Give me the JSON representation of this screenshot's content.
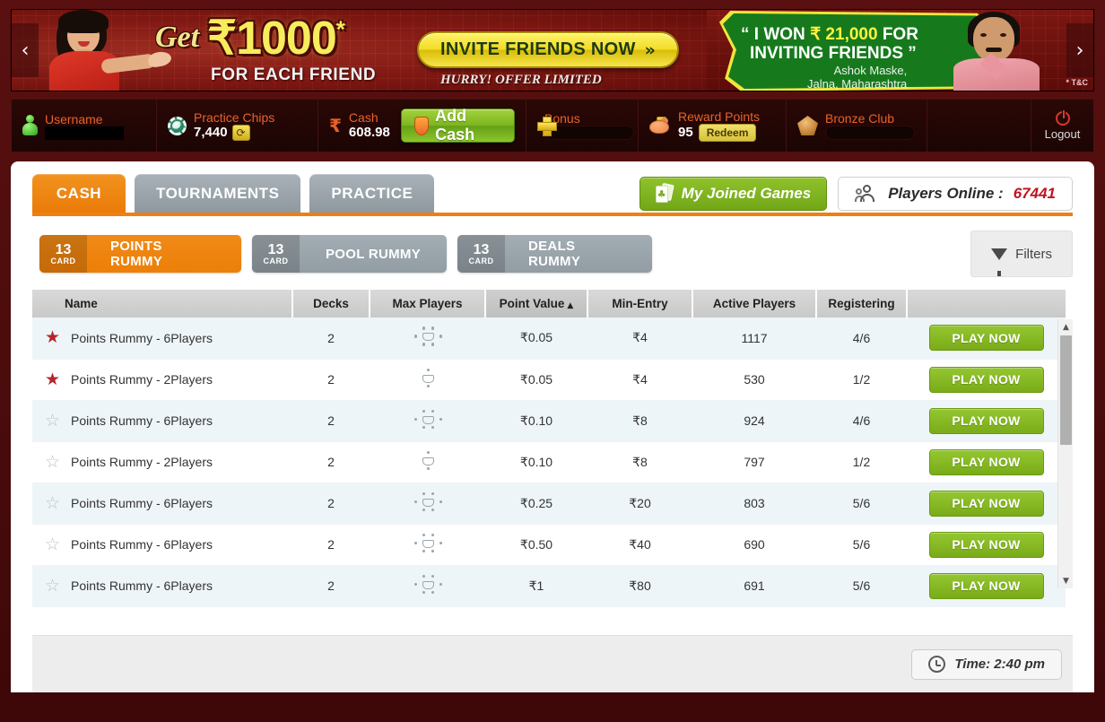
{
  "banner": {
    "prev_arrow": "‹",
    "next_arrow": "›",
    "get_word": "Get",
    "amount": "₹1000",
    "amount_star": "*",
    "for_each_friend": "FOR EACH FRIEND",
    "invite_label": "INVITE FRIENDS NOW",
    "invite_chevron": "»",
    "hurry": "HURRY! OFFER LIMITED",
    "quote_line1_pre": "“ I WON ",
    "quote_amount": "₹ 21,000",
    "quote_line1_post": " FOR",
    "quote_line2": "INVITING FRIENDS ”",
    "winner_name": "Ashok Maske,",
    "winner_place": "Jalna, Maharashtra",
    "tac": "* T&C"
  },
  "userbar": {
    "username_label": "Username",
    "username_value": "",
    "practice_label": "Practice Chips",
    "practice_value": "7,440",
    "refresh_icon": "⟳",
    "cash_label": "Cash",
    "cash_value": "608.98",
    "rupee_symbol": "₹",
    "add_cash_label": "Add Cash",
    "bonus_label": "Bonus",
    "bonus_value": "",
    "reward_label": "Reward Points",
    "reward_value": "95",
    "redeem_label": "Redeem",
    "bronze_label": "Bronze Club",
    "bronze_value": "",
    "logout_label": "Logout"
  },
  "main_tabs": [
    {
      "label": "CASH",
      "active": true
    },
    {
      "label": "TOURNAMENTS",
      "active": false
    },
    {
      "label": "PRACTICE",
      "active": false
    }
  ],
  "joined_games_label": "My Joined Games",
  "players_online": {
    "label": "Players Online :",
    "count": "67441"
  },
  "game_tabs": [
    {
      "num": "13",
      "sub": "CARD",
      "name": "POINTS RUMMY",
      "active": true
    },
    {
      "num": "13",
      "sub": "CARD",
      "name": "POOL RUMMY",
      "active": false
    },
    {
      "num": "13",
      "sub": "CARD",
      "name": "DEALS RUMMY",
      "active": false
    }
  ],
  "filters_label": "Filters",
  "table": {
    "columns": [
      "Name",
      "Decks",
      "Max Players",
      "Point Value",
      "Min-Entry",
      "Active Players",
      "Registering",
      ""
    ],
    "sort_column": "Point Value",
    "sort_indicator": "▲",
    "rows": [
      {
        "fav": "filled",
        "name": "Points Rummy - 6Players",
        "decks": "2",
        "max_players": "6",
        "point_value": "₹0.05",
        "min_entry": "₹4",
        "active_players": "1117",
        "registering": "4/6",
        "action": "PLAY NOW"
      },
      {
        "fav": "filled",
        "name": "Points Rummy - 2Players",
        "decks": "2",
        "max_players": "2",
        "point_value": "₹0.05",
        "min_entry": "₹4",
        "active_players": "530",
        "registering": "1/2",
        "action": "PLAY NOW"
      },
      {
        "fav": "empty",
        "name": "Points Rummy - 6Players",
        "decks": "2",
        "max_players": "6",
        "point_value": "₹0.10",
        "min_entry": "₹8",
        "active_players": "924",
        "registering": "4/6",
        "action": "PLAY NOW"
      },
      {
        "fav": "empty",
        "name": "Points Rummy - 2Players",
        "decks": "2",
        "max_players": "2",
        "point_value": "₹0.10",
        "min_entry": "₹8",
        "active_players": "797",
        "registering": "1/2",
        "action": "PLAY NOW"
      },
      {
        "fav": "empty",
        "name": "Points Rummy - 6Players",
        "decks": "2",
        "max_players": "6",
        "point_value": "₹0.25",
        "min_entry": "₹20",
        "active_players": "803",
        "registering": "5/6",
        "action": "PLAY NOW"
      },
      {
        "fav": "empty",
        "name": "Points Rummy - 6Players",
        "decks": "2",
        "max_players": "6",
        "point_value": "₹0.50",
        "min_entry": "₹40",
        "active_players": "690",
        "registering": "5/6",
        "action": "PLAY NOW"
      },
      {
        "fav": "empty",
        "name": "Points Rummy - 6Players",
        "decks": "2",
        "max_players": "6",
        "point_value": "₹1",
        "min_entry": "₹80",
        "active_players": "691",
        "registering": "5/6",
        "action": "PLAY NOW"
      }
    ]
  },
  "scrollbar": {
    "up": "▲",
    "down": "▼"
  },
  "footer": {
    "time_label": "Time: 2:40 pm"
  },
  "colors": {
    "accent_orange": "#ee7f13",
    "play_green": "#86bb22",
    "brand_red": "#8d1414",
    "count_red": "#c1121f",
    "label_orange": "#e8622a"
  }
}
